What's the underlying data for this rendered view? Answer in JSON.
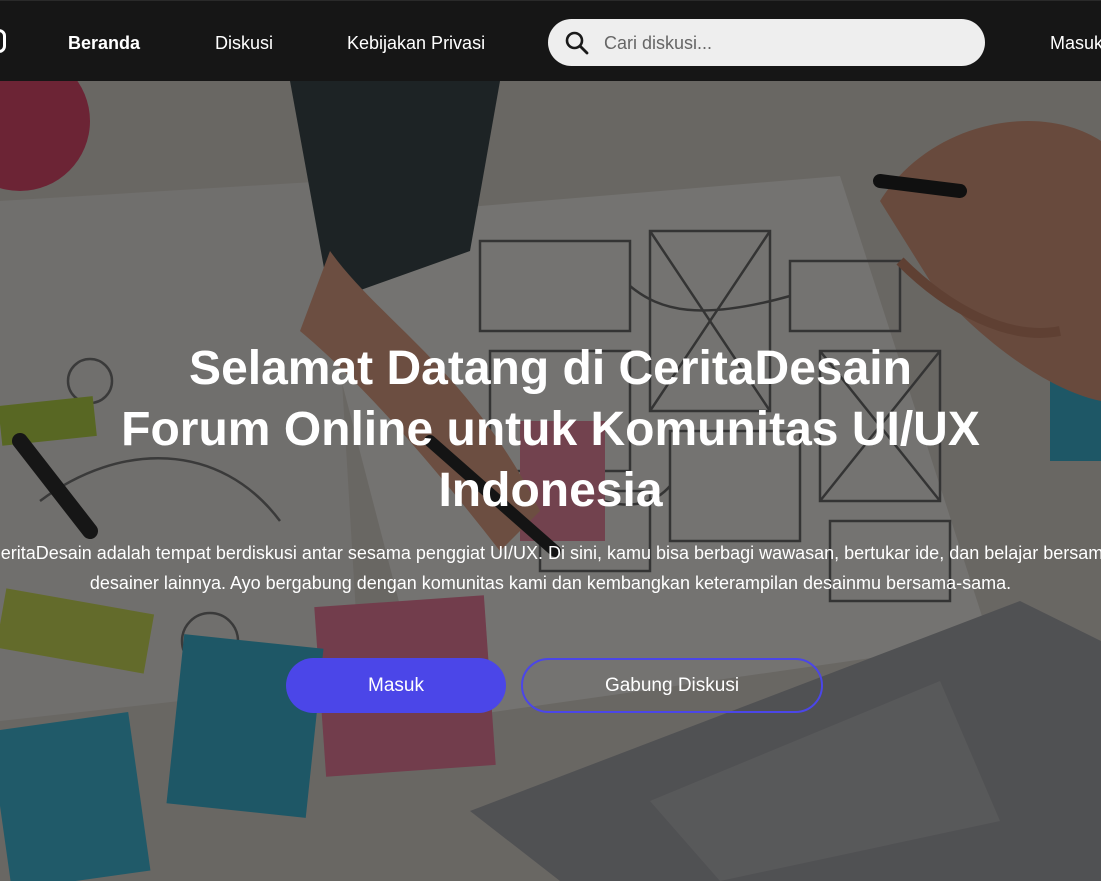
{
  "navbar": {
    "links": [
      {
        "label": "Beranda",
        "active": true
      },
      {
        "label": "Diskusi",
        "active": false
      },
      {
        "label": "Kebijakan Privasi",
        "active": false
      }
    ],
    "search": {
      "placeholder": "Cari diskusi...",
      "value": "",
      "icon": "search-icon"
    },
    "login_label": "Masuk"
  },
  "hero": {
    "title_lines": [
      "Selamat Datang di CeritaDesain",
      "Forum Online untuk Komunitas UI/UX",
      "Indonesia"
    ],
    "description": "CeritaDesain adalah tempat berdiskusi antar sesama penggiat UI/UX. Di sini, kamu bisa berbagi wawasan, bertukar ide, dan belajar bersama desainer lainnya. Ayo bergabung dengan komunitas kami dan kembangkan keterampilan desainmu bersama-sama.",
    "primary_button": "Masuk",
    "secondary_button": "Gabung Diskusi"
  },
  "colors": {
    "navbar_bg": "#161616",
    "accent": "#4b46e8",
    "search_bg": "#eeeeee"
  }
}
